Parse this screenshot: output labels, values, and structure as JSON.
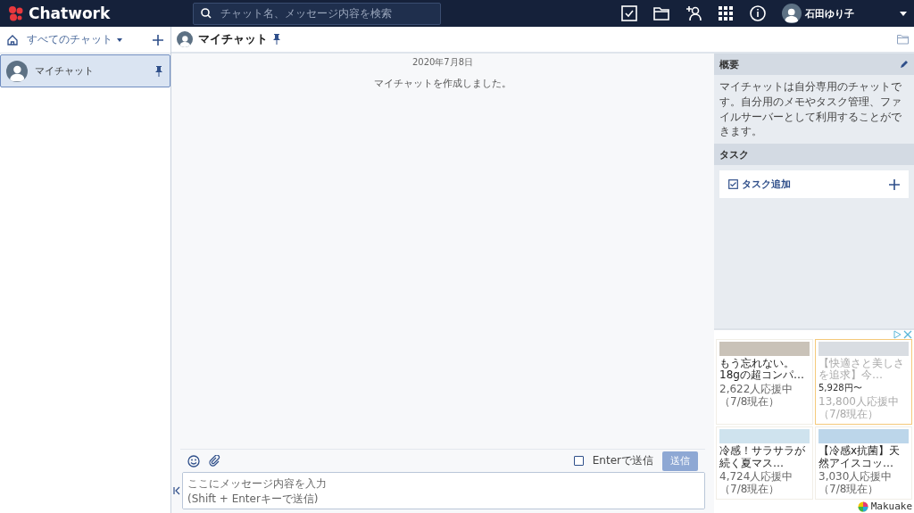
{
  "header": {
    "logo": "Chatwork",
    "search": {
      "placeholder": "チャット名、メッセージ内容を検索"
    },
    "user": {
      "name": "石田ゆり子"
    }
  },
  "sidebar": {
    "filter": "すべてのチャット",
    "rooms": [
      {
        "name": "マイチャット",
        "selected": true,
        "pinned": true
      }
    ]
  },
  "chat": {
    "title": "マイチャット",
    "pinned": true,
    "date": "2020年7月8日",
    "messages": [
      "マイチャットを作成しました。"
    ],
    "composer": {
      "enter_label": "Enterで送信",
      "enter_checked": false,
      "send": "送信",
      "send_disabled": true,
      "placeholder": "ここにメッセージ内容を入力\n(Shift + Enterキーで送信)"
    }
  },
  "panel": {
    "overview_title": "概要",
    "overview": "マイチャットは自分専用のチャットです。自分用のメモやタスク管理、ファイルサーバーとして利用することができます。",
    "tasks_title": "タスク",
    "add_task": "タスク追加"
  },
  "ads": {
    "items": [
      {
        "caption": "もう忘れない。18gの超コンパ…",
        "supporters": "2,622人応援中（7/8現在）",
        "selected": false,
        "color": "#c9c2b8"
      },
      {
        "caption": "【快適さと美しさを追求】今…",
        "supporters": "13,800人応援中（7/8現在）",
        "price": "5,928円〜",
        "selected": true,
        "color": "#d9dde2"
      },
      {
        "caption": "冷感！サラサラが続く夏マス…",
        "supporters": "4,724人応援中（7/8現在）",
        "selected": false,
        "color": "#cfe3ee"
      },
      {
        "caption": "【冷感x抗菌】天然アイスコッ…",
        "supporters": "3,030人応援中（7/8現在）",
        "selected": false,
        "color": "#bcd6ea"
      }
    ],
    "brand": "Makuake"
  }
}
